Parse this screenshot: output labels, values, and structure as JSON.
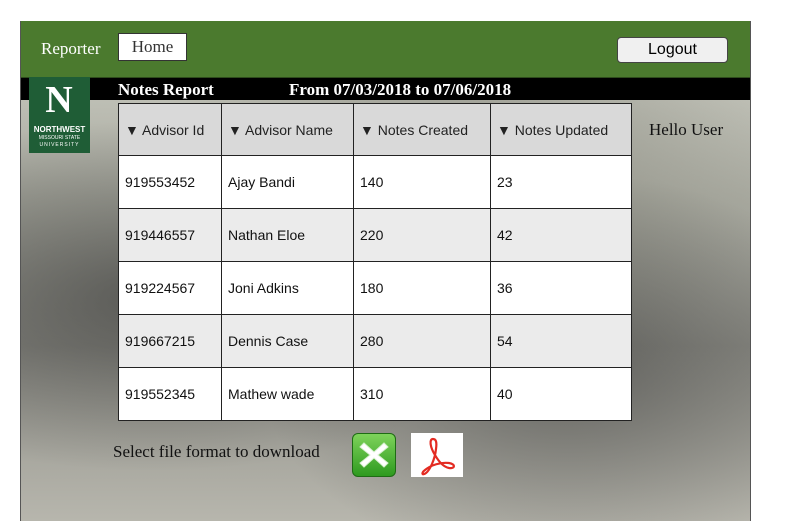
{
  "header": {
    "brand": "Reporter",
    "home_label": "Home",
    "logout_label": "Logout"
  },
  "subheader": {
    "report_title": "Notes Report",
    "date_range": "From 07/03/2018 to  07/06/2018"
  },
  "logo": {
    "letter": "N",
    "line1": "NORTHWEST",
    "line2": "MISSOURI STATE",
    "line3": "UNIVERSITY"
  },
  "greeting": "Hello User",
  "table": {
    "sort_indicator": "▼",
    "columns": [
      "Advisor Id",
      "Advisor Name",
      "Notes Created",
      "Notes Updated"
    ],
    "rows": [
      [
        "919553452",
        "Ajay Bandi",
        "140",
        "23"
      ],
      [
        "919446557",
        "Nathan Eloe",
        "220",
        "42"
      ],
      [
        "919224567",
        "Joni Adkins",
        "180",
        "36"
      ],
      [
        "919667215",
        "Dennis Case",
        "280",
        "54"
      ],
      [
        "919552345",
        "Mathew wade",
        "310",
        "40"
      ]
    ]
  },
  "download": {
    "label": "Select file format to download",
    "excel_icon": "excel-icon",
    "pdf_icon": "pdf-icon"
  },
  "colors": {
    "topbar": "#4b7a2e",
    "subbar": "#000000",
    "logo_green": "#1f5d36"
  }
}
